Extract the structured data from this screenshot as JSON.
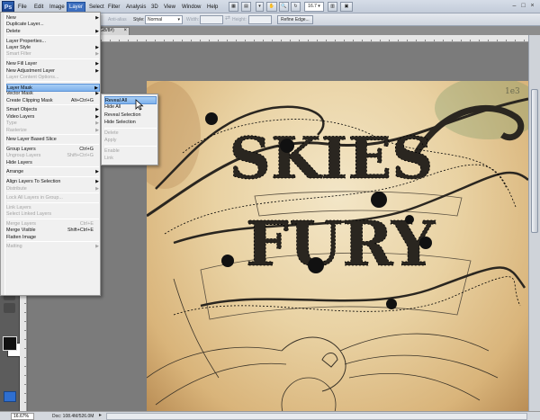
{
  "app": {
    "logo_text": "Ps"
  },
  "menubar": {
    "items": [
      "File",
      "Edit",
      "Image",
      "Layer",
      "Select",
      "Filter",
      "Analysis",
      "3D",
      "View",
      "Window",
      "Help"
    ],
    "active": "Layer",
    "zoom_readout": "16.7"
  },
  "options_bar": {
    "anti_alias_label": "Anti-alias",
    "style_label": "Style:",
    "style_value": "Normal",
    "width_label": "Width:",
    "height_label": "Height:",
    "refine_edge_label": "Refine Edge..."
  },
  "document_tab": {
    "title": "GB/8#)",
    "close": "×"
  },
  "layer_menu": {
    "items": [
      {
        "label": "New",
        "submenu": true
      },
      {
        "label": "Duplicate Layer..."
      },
      {
        "label": "Delete",
        "submenu": true
      },
      {
        "sep": true
      },
      {
        "label": "Layer Properties..."
      },
      {
        "label": "Layer Style",
        "submenu": true
      },
      {
        "label": "Smart Filter",
        "submenu": true,
        "disabled": true
      },
      {
        "sep": true
      },
      {
        "label": "New Fill Layer",
        "submenu": true
      },
      {
        "label": "New Adjustment Layer",
        "submenu": true
      },
      {
        "label": "Layer Content Options...",
        "disabled": true
      },
      {
        "sep": true
      },
      {
        "label": "Layer Mask",
        "submenu": true,
        "highlighted": true
      },
      {
        "label": "Vector Mask",
        "submenu": true
      },
      {
        "label": "Create Clipping Mask",
        "shortcut": "Alt+Ctrl+G"
      },
      {
        "sep": true
      },
      {
        "label": "Smart Objects",
        "submenu": true
      },
      {
        "label": "Video Layers",
        "submenu": true
      },
      {
        "label": "Type",
        "submenu": true,
        "disabled": true
      },
      {
        "label": "Rasterize",
        "submenu": true,
        "disabled": true
      },
      {
        "sep": true
      },
      {
        "label": "New Layer Based Slice"
      },
      {
        "sep": true
      },
      {
        "label": "Group Layers",
        "shortcut": "Ctrl+G"
      },
      {
        "label": "Ungroup Layers",
        "shortcut": "Shift+Ctrl+G",
        "disabled": true
      },
      {
        "label": "Hide Layers"
      },
      {
        "sep": true
      },
      {
        "label": "Arrange",
        "submenu": true
      },
      {
        "sep": true
      },
      {
        "label": "Align Layers To Selection",
        "submenu": true
      },
      {
        "label": "Distribute",
        "submenu": true,
        "disabled": true
      },
      {
        "sep": true
      },
      {
        "label": "Lock All Layers in Group...",
        "disabled": true
      },
      {
        "sep": true
      },
      {
        "label": "Link Layers",
        "disabled": true
      },
      {
        "label": "Select Linked Layers",
        "disabled": true
      },
      {
        "sep": true
      },
      {
        "label": "Merge Layers",
        "shortcut": "Ctrl+E",
        "disabled": true
      },
      {
        "label": "Merge Visible",
        "shortcut": "Shift+Ctrl+E"
      },
      {
        "label": "Flatten Image"
      },
      {
        "sep": true
      },
      {
        "label": "Matting",
        "submenu": true,
        "disabled": true
      }
    ]
  },
  "layer_mask_submenu": {
    "items": [
      {
        "label": "Reveal All",
        "highlighted": true
      },
      {
        "label": "Hide All"
      },
      {
        "label": "Reveal Selection"
      },
      {
        "label": "Hide Selection"
      },
      {
        "sep": true
      },
      {
        "label": "Delete",
        "disabled": true
      },
      {
        "label": "Apply",
        "disabled": true
      },
      {
        "sep": true
      },
      {
        "label": "Enable",
        "disabled": true
      },
      {
        "label": "Link",
        "disabled": true
      }
    ]
  },
  "artwork": {
    "line1": "SKIES",
    "line2": "FURY",
    "corner_mark": "1e3"
  },
  "statusbar": {
    "zoom": "16.67%",
    "doc_info": "Doc: 108.4M/526.0M",
    "arrow": "▸"
  },
  "colors": {
    "accent": "#3d6fbf",
    "menu_bg": "#f0f0f0",
    "ink": "#2a2620",
    "parchment": "#ead4a6"
  }
}
